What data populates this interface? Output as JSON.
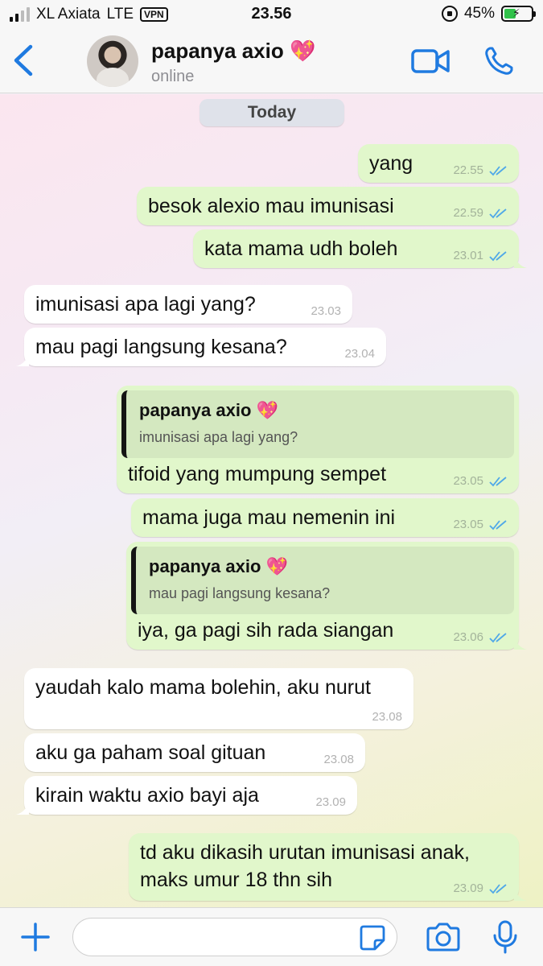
{
  "status_bar": {
    "carrier": "XL Axiata",
    "network": "LTE",
    "vpn": "VPN",
    "time": "23.56",
    "battery": "45%",
    "battery_level": 0.45
  },
  "header": {
    "contact_name": "papanya axio 💖",
    "contact_status": "online"
  },
  "chat": {
    "day_label": "Today",
    "messages": [
      {
        "dir": "out",
        "text": "yang",
        "time": "22.55"
      },
      {
        "dir": "out",
        "text": "besok alexio mau imunisasi",
        "time": "22.59"
      },
      {
        "dir": "out",
        "text": "kata mama udh boleh",
        "time": "23.01"
      },
      {
        "dir": "in",
        "text": "imunisasi apa lagi yang?",
        "time": "23.03"
      },
      {
        "dir": "in",
        "text": "mau pagi langsung kesana?",
        "time": "23.04"
      },
      {
        "dir": "out",
        "quote_name": "papanya axio 💖",
        "quote_text": "imunisasi apa lagi yang?",
        "text": "tifoid yang mumpung sempet",
        "time": "23.05"
      },
      {
        "dir": "out",
        "text": "mama juga mau nemenin ini",
        "time": "23.05"
      },
      {
        "dir": "out",
        "quote_name": "papanya axio 💖",
        "quote_text": "mau pagi langsung kesana?",
        "text": "iya, ga pagi sih rada siangan",
        "time": "23.06"
      },
      {
        "dir": "in",
        "text": "yaudah kalo mama bolehin, aku nurut",
        "time": "23.08"
      },
      {
        "dir": "in",
        "text": "aku ga paham soal gituan",
        "time": "23.08"
      },
      {
        "dir": "in",
        "text": "kirain waktu axio bayi aja",
        "time": "23.09"
      },
      {
        "dir": "out",
        "text": "td aku dikasih urutan imunisasi anak,",
        "text_line2": "maks umur 18 thn sih",
        "time": "23.09"
      }
    ]
  },
  "input_bar": {
    "value": "",
    "placeholder": ""
  },
  "colors": {
    "accent": "#1f7ae0",
    "outgoing_bubble": "#e1f7cb",
    "incoming_bubble": "#ffffff",
    "read_ticks": "#4fa8e8"
  }
}
